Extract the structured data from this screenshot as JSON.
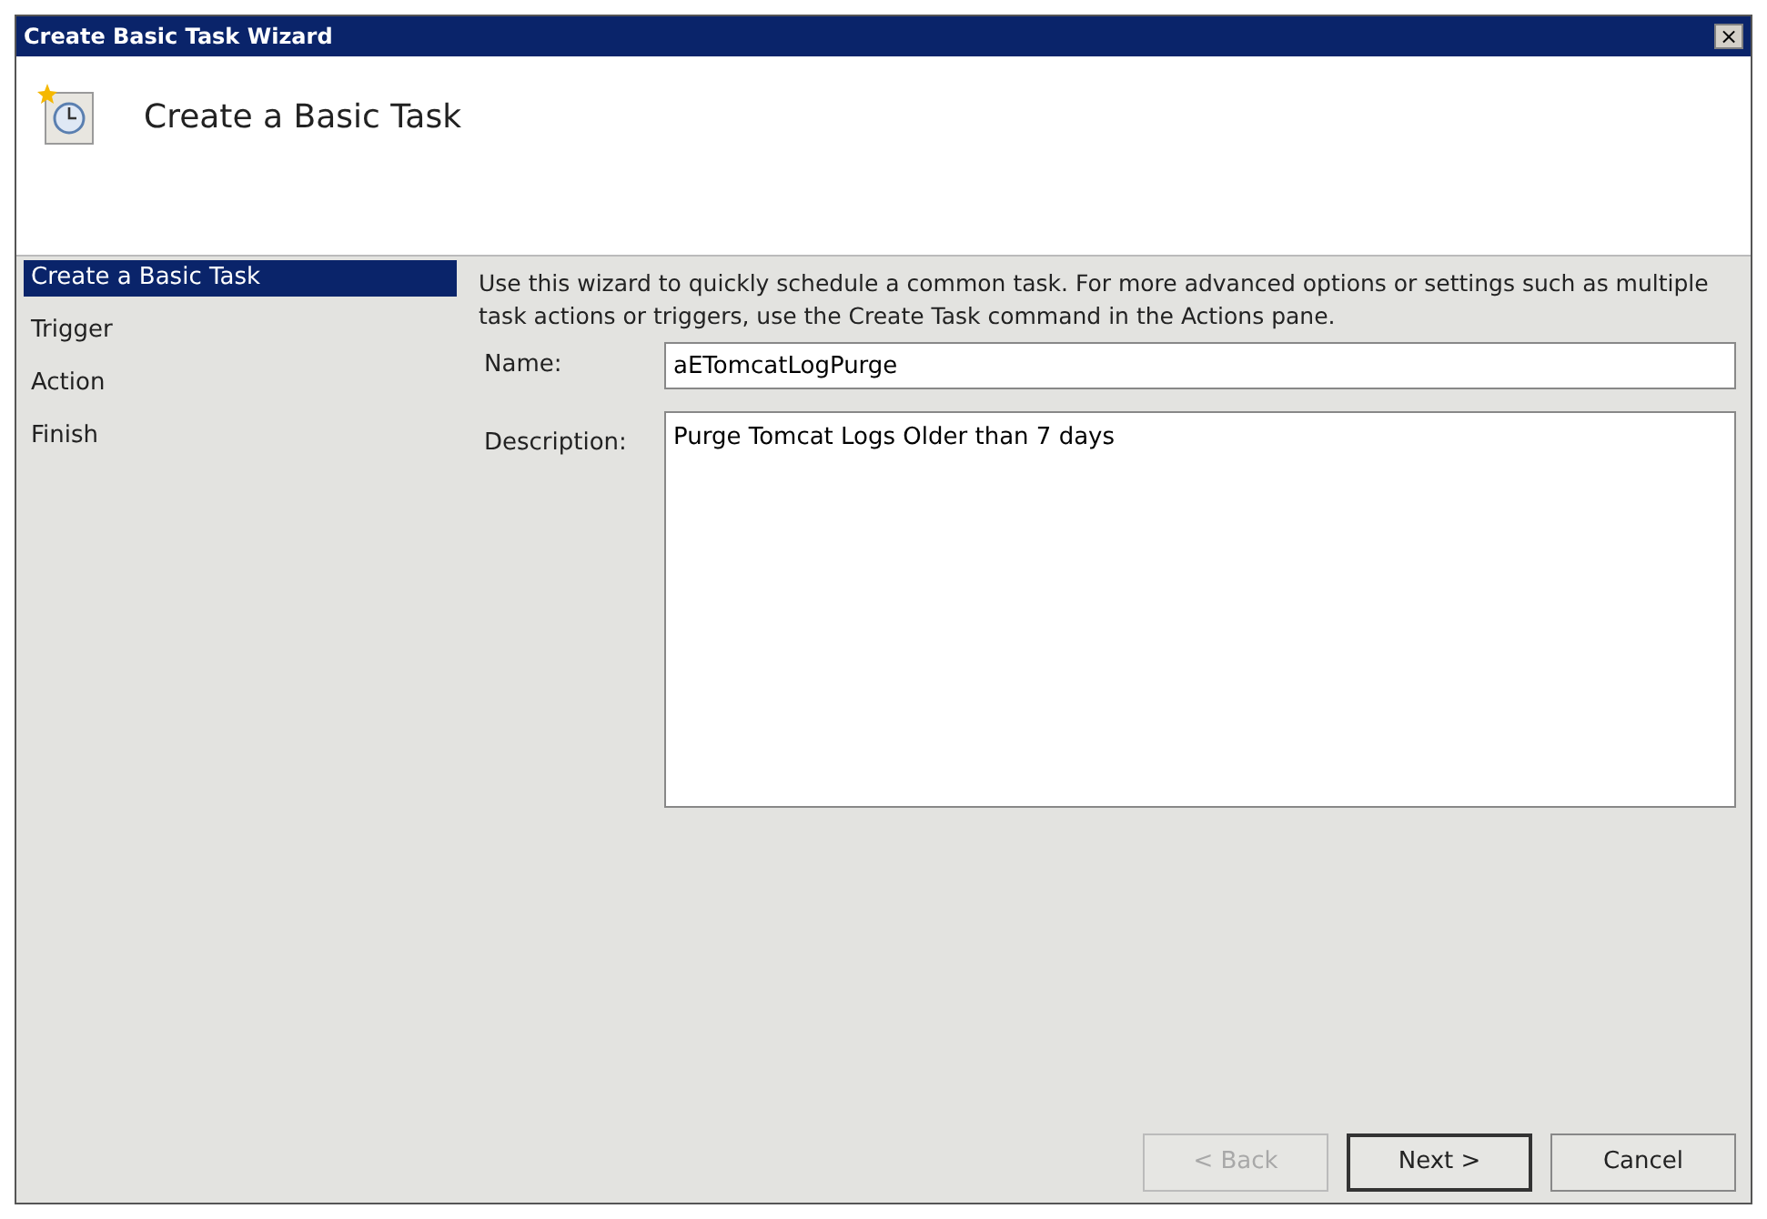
{
  "window": {
    "title": "Create Basic Task Wizard",
    "close": "×"
  },
  "header": {
    "title": "Create a Basic Task"
  },
  "steps": [
    {
      "label": "Create a Basic Task",
      "selected": true
    },
    {
      "label": "Trigger",
      "selected": false
    },
    {
      "label": "Action",
      "selected": false
    },
    {
      "label": "Finish",
      "selected": false
    }
  ],
  "intro": "Use this wizard to quickly schedule a common task.  For more advanced options or settings such as multiple task actions or triggers, use the Create Task command in the Actions pane.",
  "name_field": {
    "label": "Name:",
    "value": "aETomcatLogPurge"
  },
  "description_field": {
    "label": "Description:",
    "value": "Purge Tomcat Logs Older than 7 days"
  },
  "buttons": [
    {
      "label": "< Back",
      "disabled": true,
      "default": false
    },
    {
      "label": "Next >",
      "disabled": false,
      "default": true
    },
    {
      "label": "Cancel",
      "disabled": false,
      "default": false
    }
  ]
}
